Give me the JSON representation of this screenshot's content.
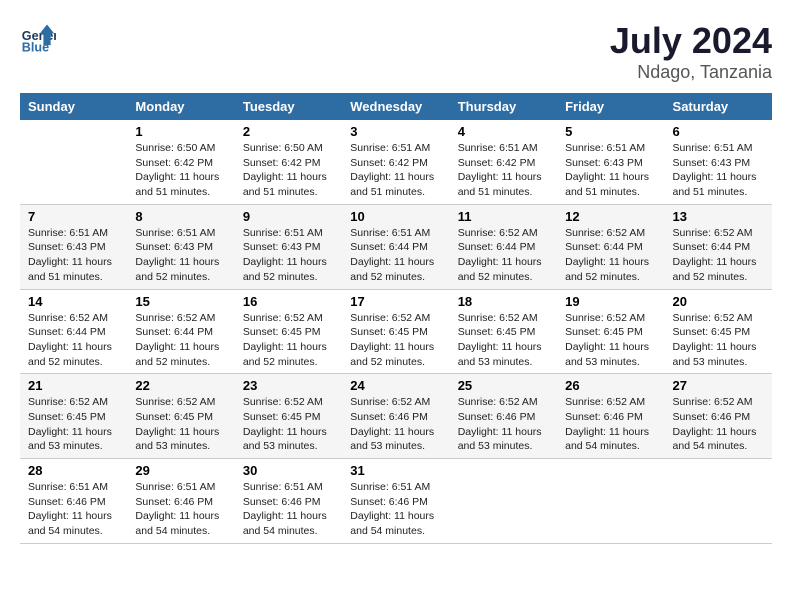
{
  "header": {
    "logo_line1": "General",
    "logo_line2": "Blue",
    "title": "July 2024",
    "subtitle": "Ndago, Tanzania"
  },
  "columns": [
    "Sunday",
    "Monday",
    "Tuesday",
    "Wednesday",
    "Thursday",
    "Friday",
    "Saturday"
  ],
  "weeks": [
    [
      {
        "day": "",
        "info": ""
      },
      {
        "day": "1",
        "info": "Sunrise: 6:50 AM\nSunset: 6:42 PM\nDaylight: 11 hours\nand 51 minutes."
      },
      {
        "day": "2",
        "info": "Sunrise: 6:50 AM\nSunset: 6:42 PM\nDaylight: 11 hours\nand 51 minutes."
      },
      {
        "day": "3",
        "info": "Sunrise: 6:51 AM\nSunset: 6:42 PM\nDaylight: 11 hours\nand 51 minutes."
      },
      {
        "day": "4",
        "info": "Sunrise: 6:51 AM\nSunset: 6:42 PM\nDaylight: 11 hours\nand 51 minutes."
      },
      {
        "day": "5",
        "info": "Sunrise: 6:51 AM\nSunset: 6:43 PM\nDaylight: 11 hours\nand 51 minutes."
      },
      {
        "day": "6",
        "info": "Sunrise: 6:51 AM\nSunset: 6:43 PM\nDaylight: 11 hours\nand 51 minutes."
      }
    ],
    [
      {
        "day": "7",
        "info": "Sunrise: 6:51 AM\nSunset: 6:43 PM\nDaylight: 11 hours\nand 51 minutes."
      },
      {
        "day": "8",
        "info": "Sunrise: 6:51 AM\nSunset: 6:43 PM\nDaylight: 11 hours\nand 52 minutes."
      },
      {
        "day": "9",
        "info": "Sunrise: 6:51 AM\nSunset: 6:43 PM\nDaylight: 11 hours\nand 52 minutes."
      },
      {
        "day": "10",
        "info": "Sunrise: 6:51 AM\nSunset: 6:44 PM\nDaylight: 11 hours\nand 52 minutes."
      },
      {
        "day": "11",
        "info": "Sunrise: 6:52 AM\nSunset: 6:44 PM\nDaylight: 11 hours\nand 52 minutes."
      },
      {
        "day": "12",
        "info": "Sunrise: 6:52 AM\nSunset: 6:44 PM\nDaylight: 11 hours\nand 52 minutes."
      },
      {
        "day": "13",
        "info": "Sunrise: 6:52 AM\nSunset: 6:44 PM\nDaylight: 11 hours\nand 52 minutes."
      }
    ],
    [
      {
        "day": "14",
        "info": "Sunrise: 6:52 AM\nSunset: 6:44 PM\nDaylight: 11 hours\nand 52 minutes."
      },
      {
        "day": "15",
        "info": "Sunrise: 6:52 AM\nSunset: 6:44 PM\nDaylight: 11 hours\nand 52 minutes."
      },
      {
        "day": "16",
        "info": "Sunrise: 6:52 AM\nSunset: 6:45 PM\nDaylight: 11 hours\nand 52 minutes."
      },
      {
        "day": "17",
        "info": "Sunrise: 6:52 AM\nSunset: 6:45 PM\nDaylight: 11 hours\nand 52 minutes."
      },
      {
        "day": "18",
        "info": "Sunrise: 6:52 AM\nSunset: 6:45 PM\nDaylight: 11 hours\nand 53 minutes."
      },
      {
        "day": "19",
        "info": "Sunrise: 6:52 AM\nSunset: 6:45 PM\nDaylight: 11 hours\nand 53 minutes."
      },
      {
        "day": "20",
        "info": "Sunrise: 6:52 AM\nSunset: 6:45 PM\nDaylight: 11 hours\nand 53 minutes."
      }
    ],
    [
      {
        "day": "21",
        "info": "Sunrise: 6:52 AM\nSunset: 6:45 PM\nDaylight: 11 hours\nand 53 minutes."
      },
      {
        "day": "22",
        "info": "Sunrise: 6:52 AM\nSunset: 6:45 PM\nDaylight: 11 hours\nand 53 minutes."
      },
      {
        "day": "23",
        "info": "Sunrise: 6:52 AM\nSunset: 6:45 PM\nDaylight: 11 hours\nand 53 minutes."
      },
      {
        "day": "24",
        "info": "Sunrise: 6:52 AM\nSunset: 6:46 PM\nDaylight: 11 hours\nand 53 minutes."
      },
      {
        "day": "25",
        "info": "Sunrise: 6:52 AM\nSunset: 6:46 PM\nDaylight: 11 hours\nand 53 minutes."
      },
      {
        "day": "26",
        "info": "Sunrise: 6:52 AM\nSunset: 6:46 PM\nDaylight: 11 hours\nand 54 minutes."
      },
      {
        "day": "27",
        "info": "Sunrise: 6:52 AM\nSunset: 6:46 PM\nDaylight: 11 hours\nand 54 minutes."
      }
    ],
    [
      {
        "day": "28",
        "info": "Sunrise: 6:51 AM\nSunset: 6:46 PM\nDaylight: 11 hours\nand 54 minutes."
      },
      {
        "day": "29",
        "info": "Sunrise: 6:51 AM\nSunset: 6:46 PM\nDaylight: 11 hours\nand 54 minutes."
      },
      {
        "day": "30",
        "info": "Sunrise: 6:51 AM\nSunset: 6:46 PM\nDaylight: 11 hours\nand 54 minutes."
      },
      {
        "day": "31",
        "info": "Sunrise: 6:51 AM\nSunset: 6:46 PM\nDaylight: 11 hours\nand 54 minutes."
      },
      {
        "day": "",
        "info": ""
      },
      {
        "day": "",
        "info": ""
      },
      {
        "day": "",
        "info": ""
      }
    ]
  ]
}
